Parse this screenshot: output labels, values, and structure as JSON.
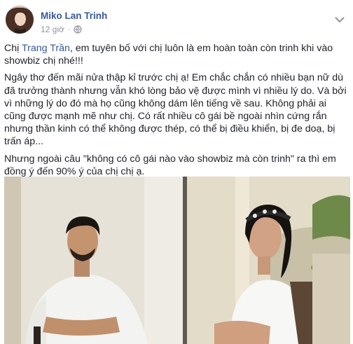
{
  "post": {
    "author": "Miko Lan Trinh",
    "timestamp": "12 giờ",
    "separator": "·",
    "privacy_icon": "globe-icon",
    "menu_icon": "chevron-down-icon",
    "paragraph1": {
      "prefix": "Chị ",
      "mention": "Trang Trần",
      "suffix": ", em tuyên bố với chị luôn là em hoàn toàn còn trinh khi vào showbiz chị nhé!!!"
    },
    "paragraph2": "Ngây thơ đến mãi nửa thập kỉ trước chị ạ! Em chắc chắn có nhiều bạn nữ dù đã trưởng thành nhưng vẫn khó lòng bảo vệ được mình vì nhiều lý do. Và bởi vì những lý do đó mà họ cũng không dám lên tiếng về sau. Không phải ai cũng được mạnh mẽ như chị. Có rất nhiều cô gái bề ngoài nhìn cứng rắn nhưng thần kinh có thể không được thép, có thể bị điều khiển, bị đe doạ, bị trấn áp...",
    "paragraph3": "Nhưng ngoài câu \"không có cô gái nào vào showbiz mà còn trinh\" ra thì em đồng ý đến 90% ý của chị chị ạ."
  },
  "colors": {
    "link": "#365899",
    "meta": "#90949c",
    "text": "#1d2129"
  }
}
